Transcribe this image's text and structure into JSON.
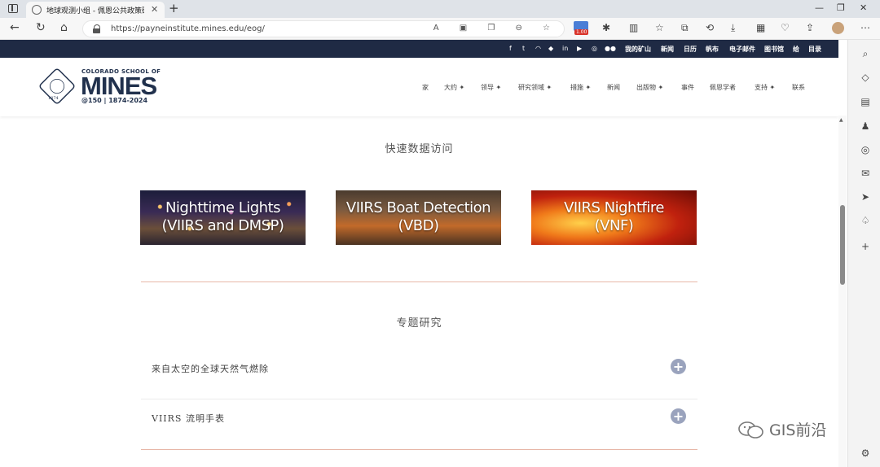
{
  "browser": {
    "tab_title": "地球观测小组 - 佩恩公共政策研究所",
    "url": "https://payneinstitute.mines.edu/eog/",
    "extension_badge": "1.00"
  },
  "site": {
    "logo": {
      "top_line": "COLORADO SCHOOL OF",
      "name": "MINES",
      "tagline": "@150 | 1874-2024",
      "seal_year": "1874"
    },
    "top_links": [
      "我的矿山",
      "新闻",
      "日历",
      "帆布",
      "电子邮件",
      "图书馆",
      "给",
      "目录"
    ],
    "main_nav": [
      "家",
      "大约 ✦",
      "领导 ✦",
      "研究领域 ✦",
      "措施 ✦",
      "新闻",
      "出版物 ✦",
      "事件",
      "佩恩学者",
      "支持 ✦",
      "联系"
    ]
  },
  "quick_data": {
    "title": "快速数据访问",
    "cards": [
      {
        "line1": "Nighttime Lights",
        "line2": "(VIIRS and DMSP)"
      },
      {
        "line1": "VIIRS Boat Detection",
        "line2": "(VBD)"
      },
      {
        "line1": "VIIRS Nightfire",
        "line2": "(VNF)"
      }
    ]
  },
  "topics": {
    "title": "专题研究",
    "items": [
      {
        "label": "来自太空的全球天然气燃除"
      },
      {
        "label": "VIIRS 流明手表"
      }
    ]
  },
  "watermark": {
    "text": "GIS前沿"
  },
  "colors": {
    "navy": "#1f2a44",
    "mines_blue": "#21314d",
    "divider": "#e7b7a8",
    "accordion_plus": "#9aa3bd"
  }
}
